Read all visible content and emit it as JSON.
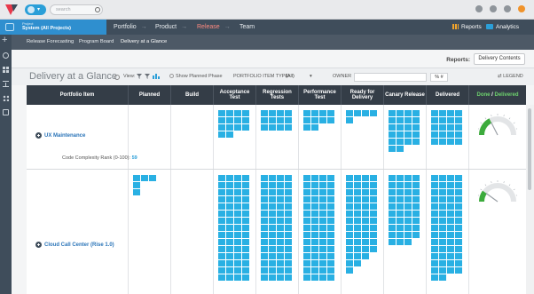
{
  "search": {
    "placeholder": "search"
  },
  "project": {
    "label": "Project",
    "name": "System (All Projects)"
  },
  "nav": {
    "items": [
      "Portfolio",
      "Product",
      "Release",
      "Team"
    ],
    "active": "Release",
    "reports": "Reports",
    "analytics": "Analytics"
  },
  "subnav": {
    "items": [
      "Release Forecasting",
      "Program Board",
      "Delivery at a Glance"
    ],
    "active": "Delivery at a Glance"
  },
  "reports_bar": {
    "label": "Reports:",
    "button": "Delivery Contents"
  },
  "page": {
    "title": "Delivery at a Glance",
    "view_label": "View:",
    "show_planned": "Show Planned Phase",
    "portfolio_type_label": "PORTFOLIO ITEM TYPE:",
    "portfolio_type_value": "(All)",
    "owner_label": "OWNER",
    "legend": "LEGEND"
  },
  "columns": [
    "Portfolio Item",
    "Planned",
    "Build",
    "Acceptance Test",
    "Regression Tests",
    "Performance Test",
    "Ready for Delivery",
    "Canary Release",
    "Delivered",
    "Done / Delivered"
  ],
  "done_label": "Done",
  "delivered_label": "Delivered",
  "rows": [
    {
      "name": "UX Maintenance",
      "rank_label": "Code Complexity Rank (0-100):",
      "rank_value": "59",
      "gauge_fraction": 0.35
    },
    {
      "name": "Cloud Call Center (Rise 1.0)",
      "gauge_fraction": 0.2
    }
  ],
  "colors": {
    "tile": "#29b0e3",
    "header": "#343d47",
    "nav": "#3f4d5b",
    "project": "#2f8fcf",
    "active_nav": "#ff8a80",
    "done_green": "#6ed36e",
    "gauge_green": "#3cab3c"
  },
  "icons": {
    "logo": "version-one-logo",
    "search": "search-icon",
    "settings": "gear-icon",
    "notifications": "bell-icon",
    "user": "avatar-icon"
  }
}
